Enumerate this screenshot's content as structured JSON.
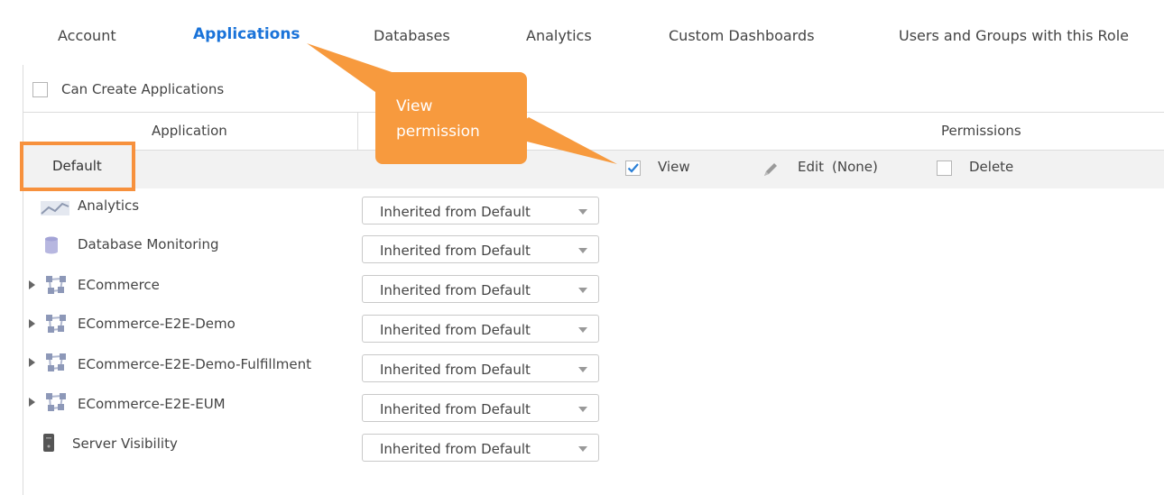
{
  "tabs": [
    {
      "label": "Account"
    },
    {
      "label": "Applications"
    },
    {
      "label": "Databases"
    },
    {
      "label": "Analytics"
    },
    {
      "label": "Custom Dashboards"
    },
    {
      "label": "Users and Groups with this Role"
    }
  ],
  "can_create": {
    "label": "Can Create Applications",
    "checked": false
  },
  "table": {
    "col_application": "Application",
    "col_permissions": "Permissions"
  },
  "default_row": {
    "label": "Default",
    "view_label": "View",
    "view_checked": true,
    "edit_label": "Edit",
    "edit_value": "(None)",
    "delete_label": "Delete",
    "delete_checked": false
  },
  "tooltip": {
    "line1": "View",
    "line2": "permission"
  },
  "rows": [
    {
      "name": "Analytics",
      "icon": "analytics-chart-icon",
      "expandable": false,
      "value": "Inherited from Default"
    },
    {
      "name": "Database Monitoring",
      "icon": "database-icon",
      "expandable": false,
      "value": "Inherited from Default"
    },
    {
      "name": "ECommerce",
      "icon": "application-flow-icon",
      "expandable": true,
      "value": "Inherited from Default"
    },
    {
      "name": "ECommerce-E2E-Demo",
      "icon": "application-flow-icon",
      "expandable": true,
      "value": "Inherited from Default"
    },
    {
      "name": "ECommerce-E2E-Demo-Fulfillment",
      "icon": "application-flow-icon",
      "expandable": true,
      "value": "Inherited from Default"
    },
    {
      "name": "ECommerce-E2E-EUM",
      "icon": "application-flow-icon",
      "expandable": true,
      "value": "Inherited from Default"
    },
    {
      "name": "Server Visibility",
      "icon": "server-icon",
      "expandable": false,
      "value": "Inherited from Default"
    }
  ],
  "colors": {
    "active_tab": "#1a73d9",
    "highlight": "#f7913d",
    "tooltip": "#f79a3e",
    "check": "#2a7fd6",
    "default_row_bg": "#f2f2f2"
  }
}
